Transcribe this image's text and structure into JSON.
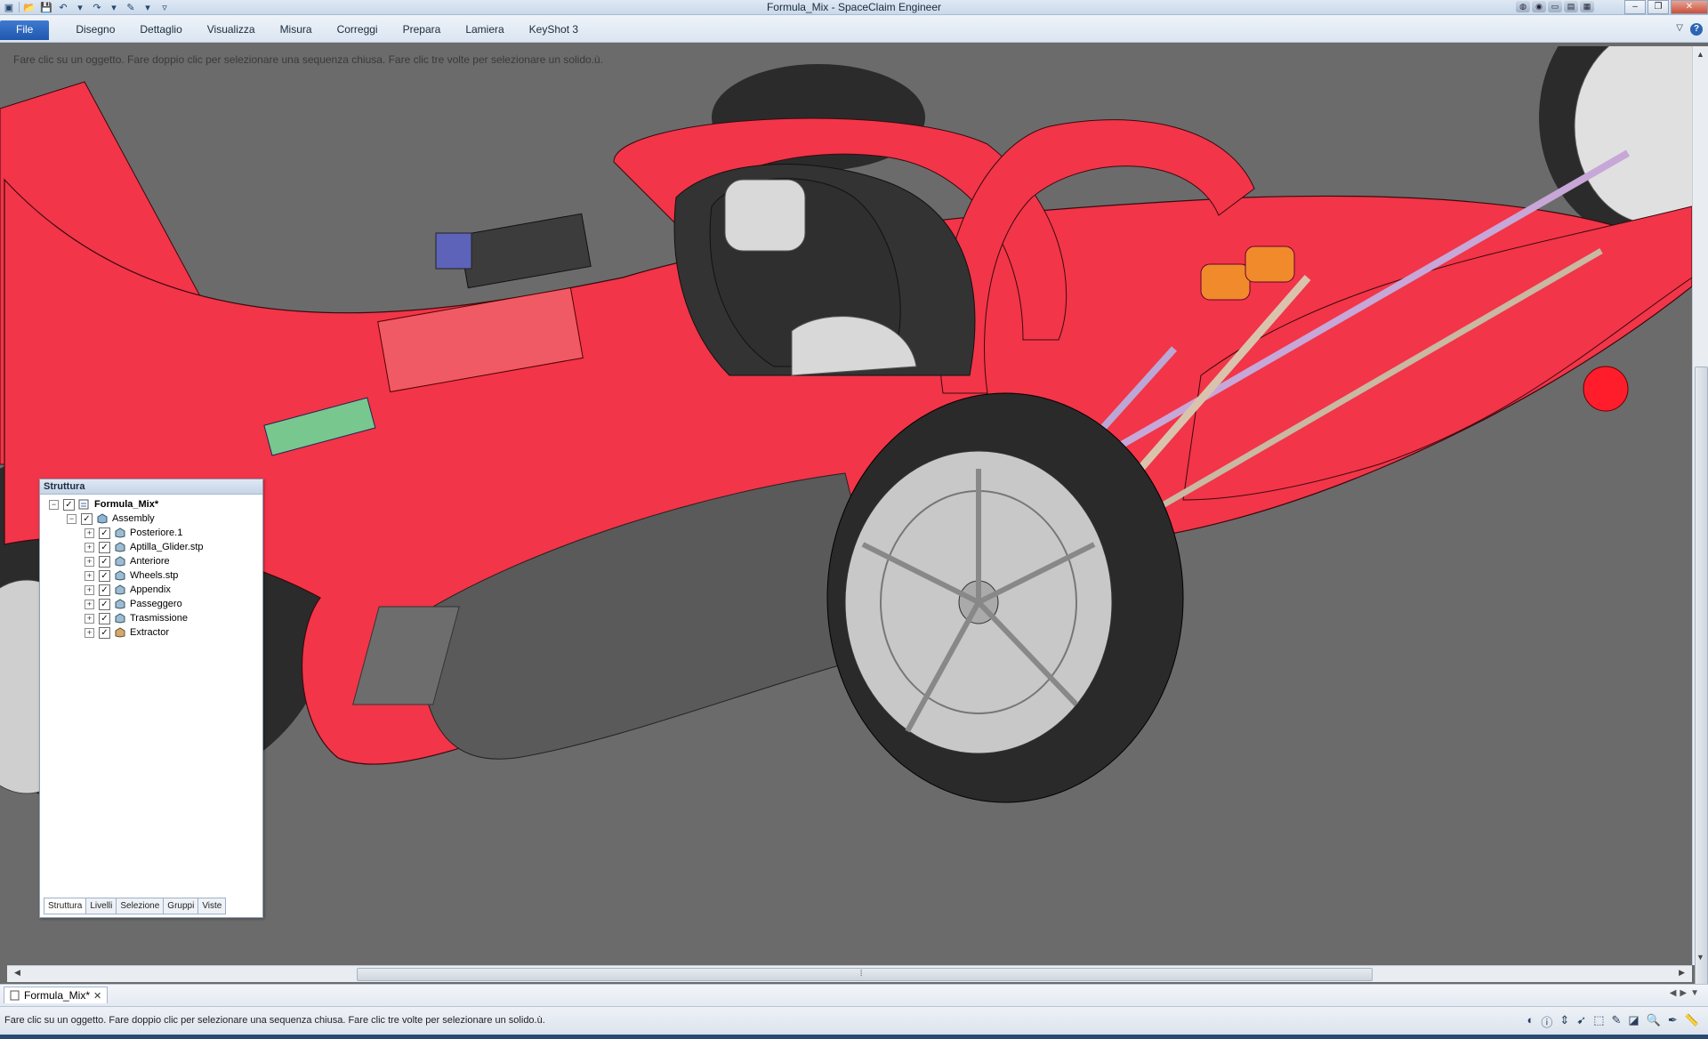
{
  "window": {
    "title": "Formula_Mix - SpaceClaim Engineer"
  },
  "ribbon": {
    "file_label": "File",
    "tabs": [
      "Disegno",
      "Dettaglio",
      "Visualizza",
      "Misura",
      "Correggi",
      "Prepara",
      "Lamiera",
      "KeyShot 3"
    ],
    "help": "?"
  },
  "viewport": {
    "hint": "Fare clic su un oggetto. Fare doppio clic per selezionare una sequenza chiusa. Fare clic tre volte per selezionare un solido.ù."
  },
  "structure_panel": {
    "header": "Struttura",
    "root": "Formula_Mix*",
    "assembly": "Assembly",
    "components": [
      "Posteriore.1",
      "Aptilla_Glider.stp",
      "Anteriore",
      "Wheels.stp",
      "Appendix",
      "Passeggero",
      "Trasmissione",
      "Extractor"
    ],
    "tabs": [
      "Struttura",
      "Livelli",
      "Selezione",
      "Gruppi",
      "Viste"
    ]
  },
  "document_tab": {
    "label": "Formula_Mix*"
  },
  "status": {
    "text": "Fare clic su un oggetto. Fare doppio clic per selezionare una sequenza chiusa. Fare clic tre volte per selezionare un solido.ù."
  },
  "colors": {
    "body_red": "#f23548",
    "tire": "#2b2b2b",
    "background": "#6b6b6b",
    "accent_blue": "#2f6bc4"
  }
}
